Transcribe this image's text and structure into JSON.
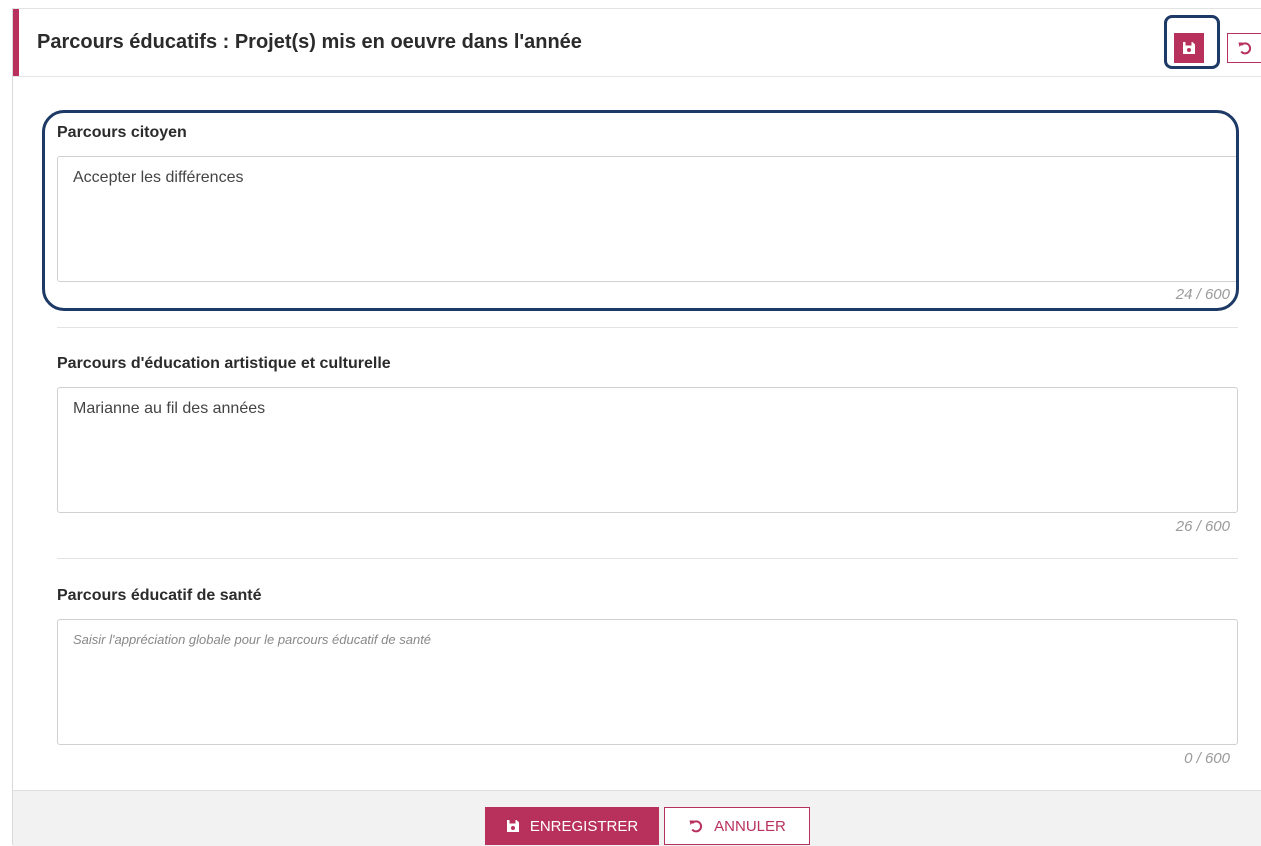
{
  "header": {
    "title": "Parcours éducatifs : Projet(s) mis en oeuvre dans l'année",
    "save_icon": "floppy-disk-icon",
    "cancel_icon": "undo-icon"
  },
  "fields": [
    {
      "label": "Parcours citoyen",
      "value": "Accepter les différences",
      "placeholder": "",
      "counter": "24 / 600"
    },
    {
      "label": "Parcours d'éducation artistique et culturelle",
      "value": "Marianne au fil des années",
      "placeholder": "",
      "counter": "26 / 600"
    },
    {
      "label": "Parcours éducatif de santé",
      "value": "",
      "placeholder": "Saisir l'appréciation globale pour le parcours éducatif de santé",
      "counter": "0 / 600"
    }
  ],
  "footer": {
    "save_label": "ENREGISTRER",
    "cancel_label": "ANNULER"
  },
  "colors": {
    "accent": "#b7315c",
    "highlight": "#1d3a66"
  }
}
